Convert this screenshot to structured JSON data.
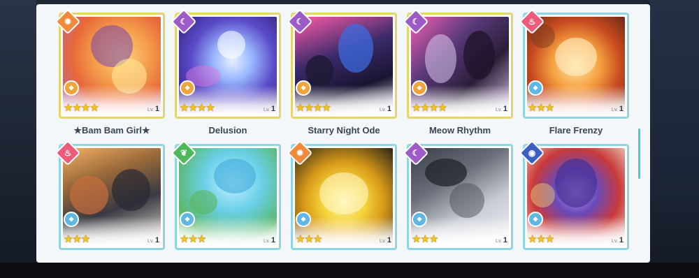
{
  "cards_row1": [
    {
      "name": "★Bam Bam Girl★",
      "attribute_icon": "sun-icon",
      "rank_icon": "rank-icon",
      "level_label": "Lv.",
      "level": "1",
      "stars": "★★★★",
      "frame": "gold"
    },
    {
      "name": "Delusion",
      "attribute_icon": "moon-icon",
      "rank_icon": "rank-icon",
      "level_label": "Lv.",
      "level": "1",
      "stars": "★★★★",
      "frame": "gold"
    },
    {
      "name": "Starry Night Ode",
      "attribute_icon": "moon-icon",
      "rank_icon": "rank-icon",
      "level_label": "Lv.",
      "level": "1",
      "stars": "★★★★",
      "frame": "gold"
    },
    {
      "name": "Meow Rhythm",
      "attribute_icon": "moon-icon",
      "rank_icon": "rank-icon",
      "level_label": "Lv.",
      "level": "1",
      "stars": "★★★★",
      "frame": "gold"
    },
    {
      "name": "Flare Frenzy",
      "attribute_icon": "flame-icon",
      "rank_icon": "rank-icon",
      "level_label": "Lv.",
      "level": "1",
      "stars": "★★★",
      "frame": "blue"
    }
  ],
  "cards_row2": [
    {
      "attribute_icon": "flame-icon",
      "rank_icon": "rank-icon",
      "level_label": "Lv.",
      "level": "1",
      "stars": "★★★",
      "frame": "blue"
    },
    {
      "attribute_icon": "leaf-icon",
      "rank_icon": "rank-icon",
      "level_label": "Lv.",
      "level": "1",
      "stars": "★★★",
      "frame": "blue"
    },
    {
      "attribute_icon": "sun-icon",
      "rank_icon": "rank-icon",
      "level_label": "Lv.",
      "level": "1",
      "stars": "★★★",
      "frame": "blue"
    },
    {
      "attribute_icon": "moon-icon",
      "rank_icon": "rank-icon",
      "level_label": "Lv.",
      "level": "1",
      "stars": "★★★",
      "frame": "blue"
    },
    {
      "attribute_icon": "eye-icon",
      "rank_icon": "rank-icon",
      "level_label": "Lv.",
      "level": "1",
      "stars": "★★★",
      "frame": "blue"
    }
  ],
  "colors": {
    "panel_bg": "#f4f7fa",
    "gold_frame": "#e4d46a",
    "blue_frame": "#8fd6e4",
    "star": "#f4c31f",
    "scrollbar": "#3fd0d6"
  }
}
